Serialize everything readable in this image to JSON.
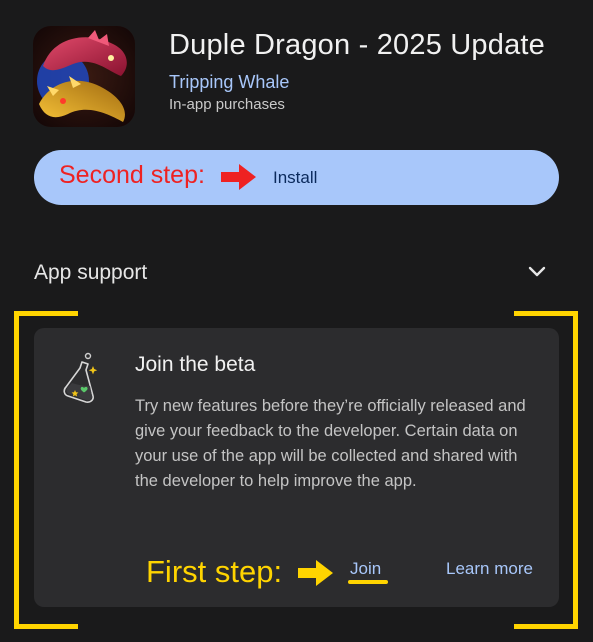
{
  "app": {
    "title": "Duple Dragon - 2025 Update",
    "developer": "Tripping Whale",
    "purchases_note": "In-app purchases",
    "icon": "dragon-app-icon"
  },
  "install": {
    "label": "Install",
    "annotation": "Second step:"
  },
  "app_support": {
    "label": "App support"
  },
  "beta": {
    "title": "Join the beta",
    "description": "Try new features before they’re officially released and give your feedback to the developer. Certain data on your use of the app will be collected and shared with the developer to help improve the app.",
    "join_label": "Join",
    "learn_more_label": "Learn more",
    "annotation": "First step:",
    "icon": "flask-icon"
  },
  "colors": {
    "background": "#1a1a1b",
    "card": "#2c2c2e",
    "accent_blue": "#a8c7fa",
    "annotation_red": "#ee2222",
    "annotation_yellow": "#ffd400"
  }
}
